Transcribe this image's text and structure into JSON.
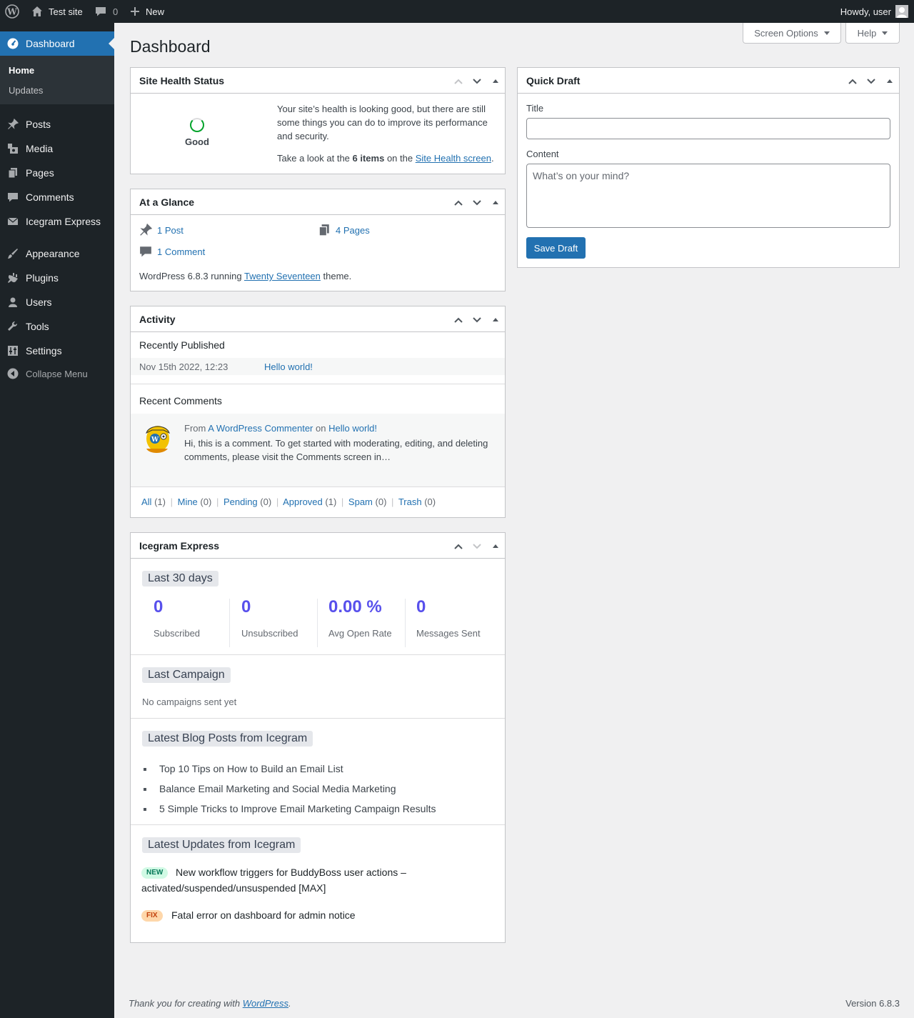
{
  "admin_bar": {
    "site_name": "Test site",
    "comments_count": "0",
    "new_label": "New",
    "howdy": "Howdy, user"
  },
  "menu": {
    "dashboard": "Dashboard",
    "submenu": [
      "Home",
      "Updates"
    ],
    "items": [
      "Posts",
      "Media",
      "Pages",
      "Comments",
      "Icegram Express",
      "Appearance",
      "Plugins",
      "Users",
      "Tools",
      "Settings"
    ],
    "collapse": "Collapse Menu"
  },
  "page": {
    "title": "Dashboard",
    "screen_options": "Screen Options",
    "help": "Help"
  },
  "site_health": {
    "title": "Site Health Status",
    "status": "Good",
    "message": "Your site’s health is looking good, but there are still some things you can do to improve its performance and security.",
    "look_prefix": "Take a look at the ",
    "items": "6 items",
    "look_mid": " on the ",
    "link": "Site Health screen",
    "look_suffix": "."
  },
  "glance": {
    "title": "At a Glance",
    "posts": "1 Post",
    "pages": "4 Pages",
    "comments": "1 Comment",
    "version_prefix": "WordPress 6.8.3 running ",
    "theme": "Twenty Seventeen",
    "version_suffix": " theme."
  },
  "activity": {
    "title": "Activity",
    "recently_published": "Recently Published",
    "post_date": "Nov 15th 2022, 12:23",
    "post_title": "Hello world!",
    "recent_comments": "Recent Comments",
    "comment_from": "From",
    "commenter": "A WordPress Commenter",
    "comment_on": "on",
    "comment_post": "Hello world!",
    "comment_text": "Hi, this is a comment. To get started with moderating, editing, and deleting comments, please visit the Comments screen in…",
    "filters": [
      {
        "label": "All",
        "count": "(1)"
      },
      {
        "label": "Mine",
        "count": "(0)"
      },
      {
        "label": "Pending",
        "count": "(0)"
      },
      {
        "label": "Approved",
        "count": "(1)"
      },
      {
        "label": "Spam",
        "count": "(0)"
      },
      {
        "label": "Trash",
        "count": "(0)"
      }
    ]
  },
  "icegram": {
    "title": "Icegram Express",
    "period": "Last 30 days",
    "stats": [
      {
        "value": "0",
        "label": "Subscribed"
      },
      {
        "value": "0",
        "label": "Unsubscribed"
      },
      {
        "value": "0.00 %",
        "label": "Avg Open Rate"
      },
      {
        "value": "0",
        "label": "Messages Sent"
      }
    ],
    "last_campaign": "Last Campaign",
    "no_campaigns": "No campaigns sent yet",
    "blog_heading": "Latest Blog Posts from Icegram",
    "blog_posts": [
      "Top 10 Tips on How to Build an Email List",
      "Balance Email Marketing and Social Media Marketing",
      "5 Simple Tricks to Improve Email Marketing Campaign Results"
    ],
    "updates_heading": "Latest Updates from Icegram",
    "updates": [
      {
        "badge": "NEW",
        "text_line1": "New workflow triggers for BuddyBoss user actions –",
        "text_line2": "activated/suspended/unsuspended [MAX]"
      },
      {
        "badge": "FIX",
        "text_line1": "Fatal error on dashboard for admin notice"
      }
    ]
  },
  "quick_draft": {
    "title": "Quick Draft",
    "title_label": "Title",
    "content_label": "Content",
    "content_placeholder": "What’s on your mind?",
    "save": "Save Draft"
  },
  "footer": {
    "thanks_prefix": "Thank you for creating with ",
    "wp_link": "WordPress",
    "thanks_suffix": ".",
    "version": "Version 6.8.3"
  },
  "colors": {
    "accent": "#2271b1",
    "admin_bar": "#1d2327",
    "good": "#00a32a",
    "icegram_stat": "#5850ec"
  }
}
